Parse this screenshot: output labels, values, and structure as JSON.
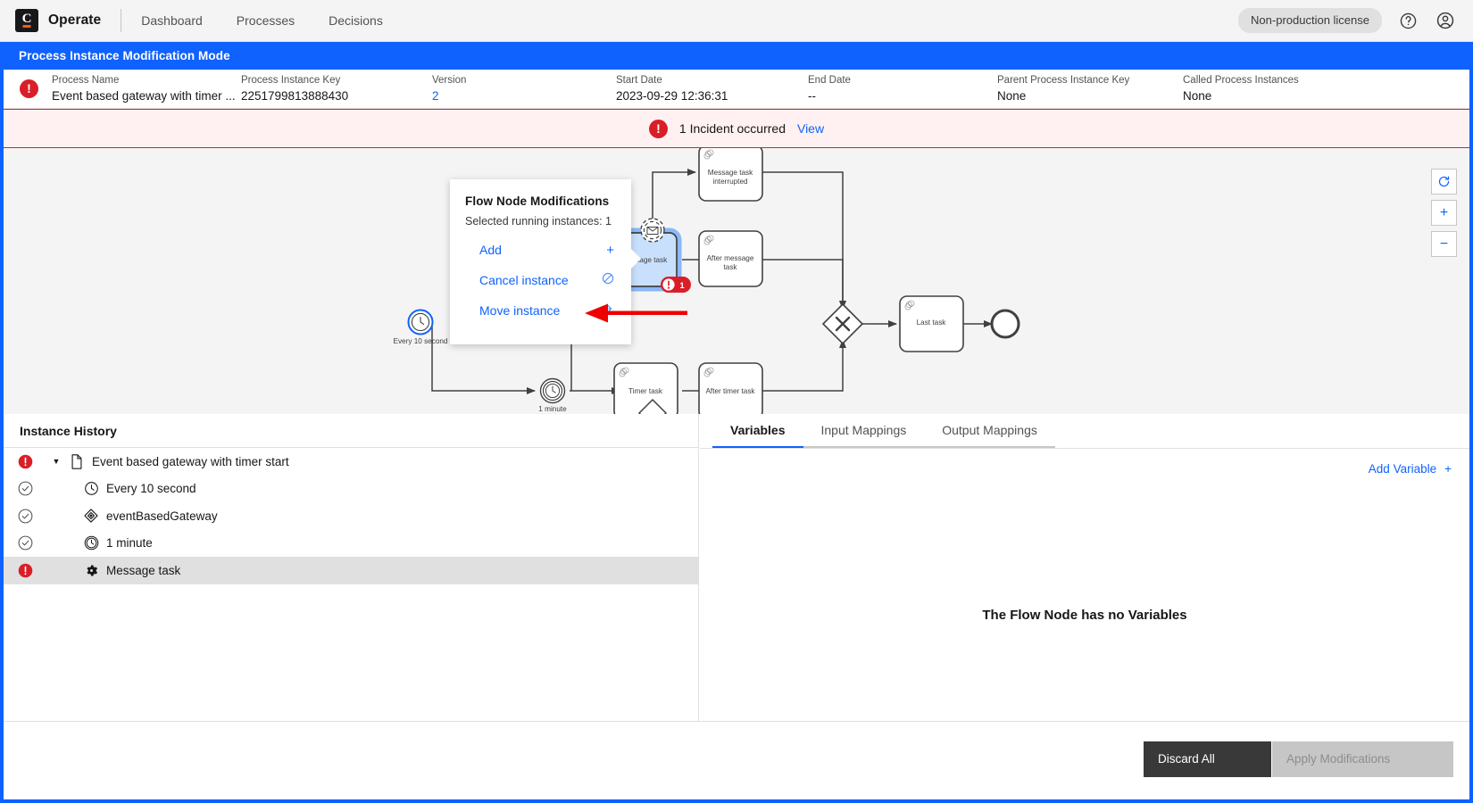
{
  "topnav": {
    "brand": "Operate",
    "logo_letter": "C",
    "links": [
      {
        "label": "Dashboard"
      },
      {
        "label": "Processes"
      },
      {
        "label": "Decisions"
      }
    ],
    "license_badge": "Non-production license",
    "help_icon": "help-circle-icon",
    "user_icon": "user-avatar-icon"
  },
  "modification_bar": {
    "title": "Process Instance Modification Mode",
    "accent": "#0f62fe"
  },
  "process_header": {
    "status_icon": "incident-error-icon",
    "fields": [
      {
        "label": "Process Name",
        "value": "Event based gateway with timer ...",
        "link": false
      },
      {
        "label": "Process Instance Key",
        "value": "2251799813888430",
        "link": false
      },
      {
        "label": "Version",
        "value": "2",
        "link": true
      },
      {
        "label": "Start Date",
        "value": "2023-09-29 12:36:31",
        "link": false
      },
      {
        "label": "End Date",
        "value": "--",
        "link": false
      },
      {
        "label": "Parent Process Instance Key",
        "value": "None",
        "link": false
      },
      {
        "label": "Called Process Instances",
        "value": "None",
        "link": false
      }
    ]
  },
  "incident_banner": {
    "icon": "incident-error-icon",
    "text": "1 Incident occurred",
    "link_label": "View",
    "background": "#fff1f1",
    "border_color": "#da1e28"
  },
  "diagram": {
    "nodes": [
      {
        "id": "message-task-interrupted",
        "label": "Message task interrupted"
      },
      {
        "id": "message-task",
        "label": "Message task",
        "selected": true,
        "incident_count": "1"
      },
      {
        "id": "after-message-task",
        "label": "After message task"
      },
      {
        "id": "last-task",
        "label": "Last task"
      },
      {
        "id": "timer-task",
        "label": "Timer task"
      },
      {
        "id": "after-timer-task",
        "label": "After timer task"
      },
      {
        "id": "timer-start-event",
        "label": "Every 10 second"
      },
      {
        "id": "timer-catch-event",
        "label": "1 minute"
      }
    ],
    "zoom_controls": [
      {
        "name": "reset-zoom-button",
        "glyph": "⭮"
      },
      {
        "name": "zoom-in-button",
        "glyph": "+"
      },
      {
        "name": "zoom-out-button",
        "glyph": "−"
      }
    ]
  },
  "popup": {
    "title": "Flow Node Modifications",
    "subtitle": "Selected running instances: 1",
    "actions": [
      {
        "label": "Add",
        "glyph": "+",
        "icon": "plus-icon"
      },
      {
        "label": "Cancel instance",
        "glyph": "⃠",
        "icon": "ban-icon"
      },
      {
        "label": "Move instance",
        "glyph": "→",
        "icon": "arrow-right-icon"
      }
    ]
  },
  "instance_history": {
    "title": "Instance History",
    "rows": [
      {
        "state": "incident",
        "label": "Event based gateway with timer start",
        "icon": "process-file-icon",
        "expanded": true,
        "level": 0,
        "selected": false
      },
      {
        "state": "completed",
        "label": "Every 10 second",
        "icon": "timer-start-icon",
        "level": 1,
        "selected": false
      },
      {
        "state": "completed",
        "label": "eventBasedGateway",
        "icon": "event-based-gateway-icon",
        "level": 1,
        "selected": false
      },
      {
        "state": "completed",
        "label": "1 minute",
        "icon": "timer-event-icon",
        "level": 1,
        "selected": false
      },
      {
        "state": "incident",
        "label": "Message task",
        "icon": "service-task-gear-icon",
        "level": 1,
        "selected": true
      }
    ]
  },
  "variables_panel": {
    "tabs": [
      {
        "label": "Variables",
        "active": true
      },
      {
        "label": "Input Mappings",
        "active": false
      },
      {
        "label": "Output Mappings",
        "active": false
      }
    ],
    "add_variable_label": "Add Variable",
    "add_variable_glyph": "+",
    "empty_message": "The Flow Node has no Variables"
  },
  "footer": {
    "discard_label": "Discard All",
    "apply_label": "Apply Modifications"
  }
}
